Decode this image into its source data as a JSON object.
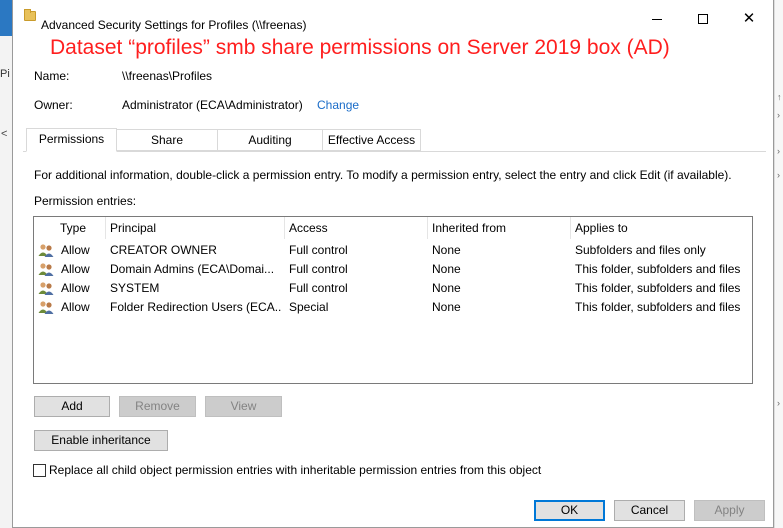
{
  "window": {
    "title": "Advanced Security Settings for Profiles (\\\\freenas)"
  },
  "annotation": "Dataset “profiles” smb share permissions on Server 2019 box (AD)",
  "background": {
    "left_text": "Pi",
    "left_arrow": "<"
  },
  "details": {
    "name_label": "Name:",
    "name_value": "\\\\freenas\\Profiles",
    "owner_label": "Owner:",
    "owner_value": "Administrator (ECA\\Administrator)",
    "change_link": "Change"
  },
  "tabs": [
    "Permissions",
    "Share",
    "Auditing",
    "Effective Access"
  ],
  "info_text": "For additional information, double-click a permission entry. To modify a permission entry, select the entry and click Edit (if available).",
  "entries_label": "Permission entries:",
  "columns": [
    "Type",
    "Principal",
    "Access",
    "Inherited from",
    "Applies to"
  ],
  "entries": [
    {
      "type": "Allow",
      "principal": "CREATOR OWNER",
      "access": "Full control",
      "inherited": "None",
      "applies": "Subfolders and files only"
    },
    {
      "type": "Allow",
      "principal": "Domain Admins (ECA\\Domai...",
      "access": "Full control",
      "inherited": "None",
      "applies": "This folder, subfolders and files"
    },
    {
      "type": "Allow",
      "principal": "SYSTEM",
      "access": "Full control",
      "inherited": "None",
      "applies": "This folder, subfolders and files"
    },
    {
      "type": "Allow",
      "principal": "Folder Redirection Users (ECA...",
      "access": "Special",
      "inherited": "None",
      "applies": "This folder, subfolders and files"
    }
  ],
  "buttons": {
    "add": "Add",
    "remove": "Remove",
    "view": "View",
    "enable_inheritance": "Enable inheritance",
    "ok": "OK",
    "cancel": "Cancel",
    "apply": "Apply"
  },
  "replace_checkbox": {
    "label": "Replace all child object permission entries with inheritable permission entries from this object",
    "checked": false
  },
  "colors": {
    "annotation": "#ff1e1e",
    "link": "#1a6cc8",
    "focus_border": "#0078d7"
  }
}
